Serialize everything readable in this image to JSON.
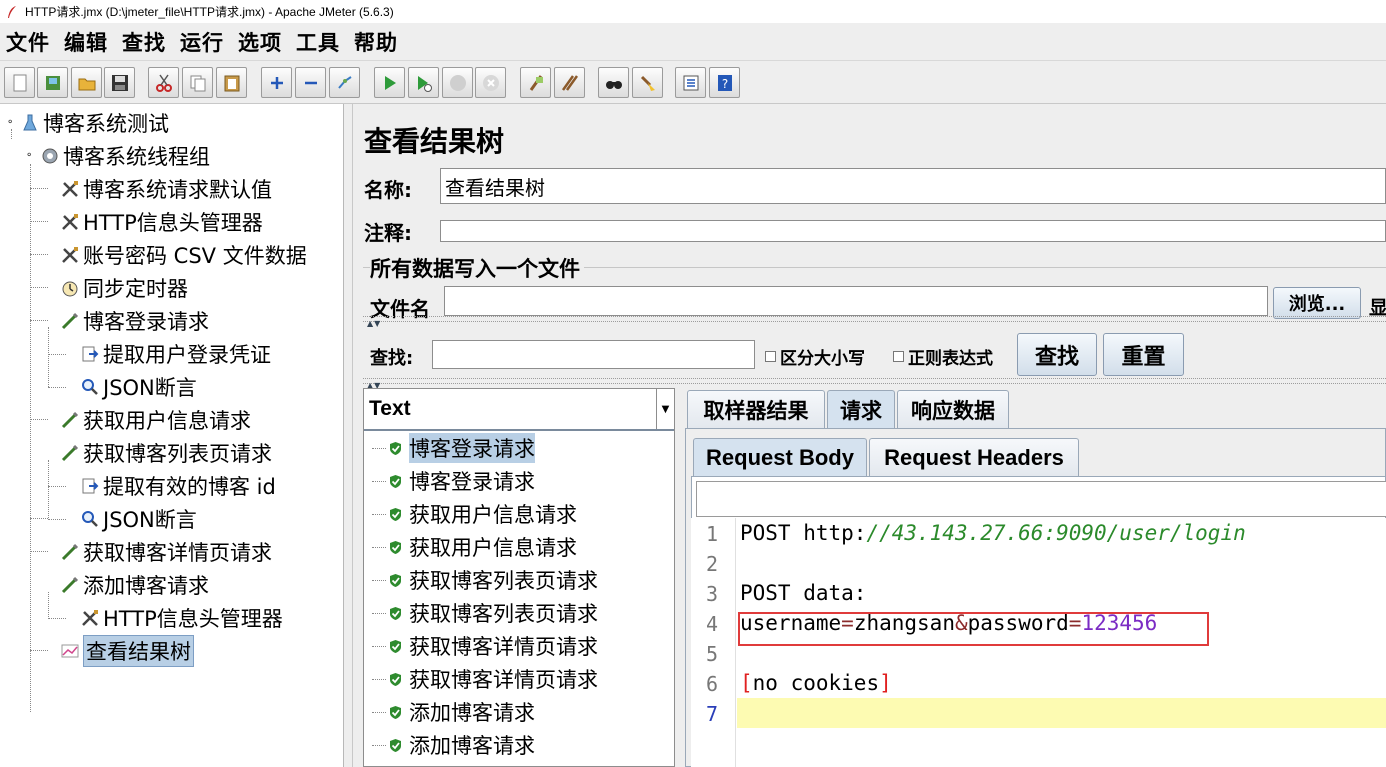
{
  "window": {
    "title": "HTTP请求.jmx (D:\\jmeter_file\\HTTP请求.jmx) - Apache JMeter (5.6.3)"
  },
  "menubar": {
    "items": [
      "文件",
      "编辑",
      "查找",
      "运行",
      "选项",
      "工具",
      "帮助"
    ]
  },
  "toolbar": {
    "buttons": [
      {
        "icon": "new-icon"
      },
      {
        "icon": "templates-icon"
      },
      {
        "icon": "open-icon"
      },
      {
        "icon": "save-icon"
      },
      {
        "icon": "cut-icon"
      },
      {
        "icon": "copy-icon"
      },
      {
        "icon": "paste-icon"
      },
      {
        "icon": "expand-icon"
      },
      {
        "icon": "collapse-icon"
      },
      {
        "icon": "toggle-icon"
      },
      {
        "icon": "start-icon"
      },
      {
        "icon": "start-no-timers-icon"
      },
      {
        "icon": "stop-icon"
      },
      {
        "icon": "shutdown-icon"
      },
      {
        "icon": "clear-icon"
      },
      {
        "icon": "clear-all-icon"
      },
      {
        "icon": "search-icon"
      },
      {
        "icon": "reset-search-icon"
      },
      {
        "icon": "function-helper-icon"
      },
      {
        "icon": "help-icon"
      }
    ]
  },
  "tree": {
    "nodes": [
      {
        "label": "博客系统测试",
        "icon": "test-plan-icon"
      },
      {
        "label": "博客系统线程组",
        "icon": "thread-group-icon"
      },
      {
        "label": "博客系统请求默认值",
        "icon": "config-icon"
      },
      {
        "label": "HTTP信息头管理器",
        "icon": "config-icon"
      },
      {
        "label": "账号密码 CSV 文件数据",
        "icon": "config-icon"
      },
      {
        "label": "同步定时器",
        "icon": "timer-icon"
      },
      {
        "label": "博客登录请求",
        "icon": "sampler-icon"
      },
      {
        "label": "提取用户登录凭证",
        "icon": "extractor-icon"
      },
      {
        "label": "JSON断言",
        "icon": "assertion-icon"
      },
      {
        "label": "获取用户信息请求",
        "icon": "sampler-icon"
      },
      {
        "label": "获取博客列表页请求",
        "icon": "sampler-icon"
      },
      {
        "label": "提取有效的博客 id",
        "icon": "extractor-icon"
      },
      {
        "label": "JSON断言",
        "icon": "assertion-icon"
      },
      {
        "label": "获取博客详情页请求",
        "icon": "sampler-icon"
      },
      {
        "label": "添加博客请求",
        "icon": "sampler-icon"
      },
      {
        "label": "HTTP信息头管理器",
        "icon": "config-icon"
      },
      {
        "label": "查看结果树",
        "icon": "listener-icon",
        "selected": true
      }
    ]
  },
  "panel": {
    "title": "查看结果树",
    "name_label": "名称:",
    "name_value": "查看结果树",
    "comment_label": "注释:",
    "comment_value": "",
    "fileset_legend": "所有数据写入一个文件",
    "filename_label": "文件名",
    "filename_value": "",
    "browse_label": "浏览...",
    "display_label_cut": "显"
  },
  "search": {
    "label": "查找:",
    "value": "",
    "case_label": "区分大小写",
    "regex_label": "正则表达式",
    "find_button": "查找",
    "reset_button": "重置"
  },
  "results": {
    "renderer": "Text",
    "items": [
      {
        "label": "博客登录请求",
        "status": "success",
        "selected": true
      },
      {
        "label": "博客登录请求",
        "status": "success"
      },
      {
        "label": "获取用户信息请求",
        "status": "success"
      },
      {
        "label": "获取用户信息请求",
        "status": "success"
      },
      {
        "label": "获取博客列表页请求",
        "status": "success"
      },
      {
        "label": "获取博客列表页请求",
        "status": "success"
      },
      {
        "label": "获取博客详情页请求",
        "status": "success"
      },
      {
        "label": "获取博客详情页请求",
        "status": "success"
      },
      {
        "label": "添加博客请求",
        "status": "success"
      },
      {
        "label": "添加博客请求",
        "status": "success"
      }
    ]
  },
  "tabs": {
    "main": [
      "取样器结果",
      "请求",
      "响应数据"
    ],
    "main_active": "请求",
    "sub": [
      "Request Body",
      "Request Headers"
    ],
    "sub_active": "Request Body"
  },
  "editor": {
    "line_numbers": [
      "1",
      "2",
      "3",
      "4",
      "5",
      "6",
      "7"
    ],
    "current_line": 7,
    "line1": {
      "method": "POST http:",
      "url": "//43.143.27.66:9090/user/login"
    },
    "line3": "POST data:",
    "line4": {
      "k1": "username",
      "eq1": "=",
      "v1": "zhangsan",
      "amp": "&",
      "k2": "password",
      "eq2": "=",
      "v2": "123456"
    },
    "line6": {
      "open": "[",
      "text": "no cookies",
      "close": "]"
    }
  },
  "colors": {
    "selection": "#b8cfe5",
    "highlight_box": "#e03b3b",
    "current_line": "#fdfbb2",
    "url": "#2b8a2b",
    "number": "#7b2bc4"
  }
}
